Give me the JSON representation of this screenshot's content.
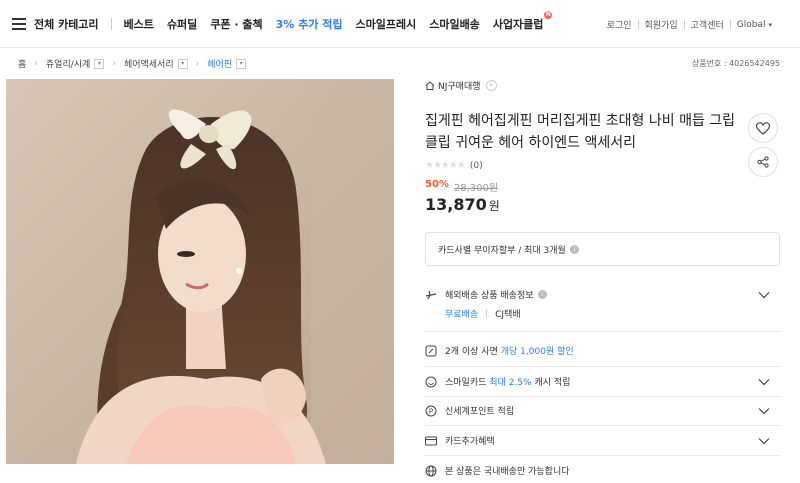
{
  "nav": {
    "all_categories": "전체 카테고리",
    "menu": [
      "베스트",
      "슈퍼딜",
      "쿠폰 · 출첵"
    ],
    "highlight": "3% 추가 적립",
    "menu2": [
      "스마일프레시",
      "스마일배송"
    ],
    "business": "사업자클럽",
    "business_badge": "N",
    "util": [
      "로그인",
      "회원가입",
      "고객센터"
    ],
    "lang": "Global"
  },
  "breadcrumb": {
    "home": "홈",
    "items": [
      "쥬얼리/시계",
      "헤어액세서리"
    ],
    "current": "헤어핀"
  },
  "product_no": "상품번호 : 4026542495",
  "store": {
    "name": "NJ구매대행"
  },
  "product": {
    "title": "집게핀 헤어집게핀 머리집게핀 초대형 나비 매듭 그립 클립 귀여운 헤어 하이엔드 액세서리",
    "review_count": "(0)",
    "discount": "50%",
    "original_price": "28,300원",
    "price": "13,870",
    "won": "원"
  },
  "card_info": "카드사별 무이자할부 / 최대 3개월",
  "shipping": {
    "label": "해외배송 상품 배송정보",
    "free": "무료배송",
    "carrier": "CJ택배"
  },
  "bundle": {
    "pre": "2개 이상 사면",
    "highlight": "개당 1,000원 할인"
  },
  "smile_card": {
    "pre": "스마일카드",
    "highlight": "최대 2.5%",
    "post": "캐시 적립"
  },
  "ssg_point": "신세계포인트 적립",
  "card_benefit": "카드추가혜택",
  "domestic": "본 상품은 국내배송만 가능합니다",
  "colors": {
    "accent": "#2f7cf6",
    "discount": "#ff5a2e"
  }
}
